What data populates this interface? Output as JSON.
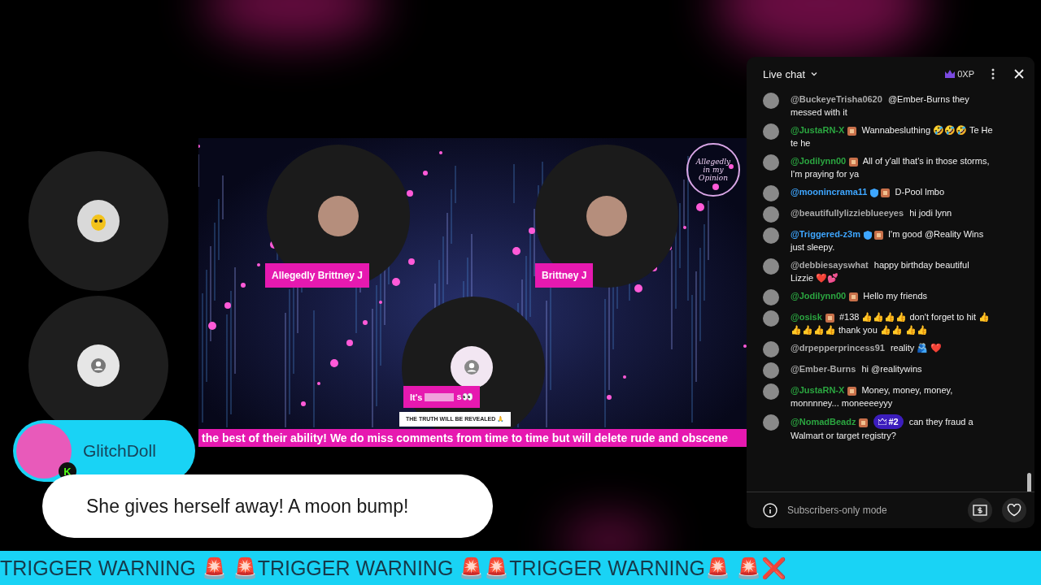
{
  "stage": {
    "side_guests": [
      {
        "kind": "mascot"
      },
      {
        "kind": "default"
      }
    ],
    "video": {
      "hosts": [
        {
          "name": "Allegedly Brittney J"
        },
        {
          "name": "Brittney J"
        }
      ],
      "guest": {
        "tag_start": "It's",
        "tag_end": "s👀",
        "caption": "THE TRUTH WILL BE REVEALED 🙏"
      },
      "logo_text": "Allegedly in my Opinion",
      "ticker": "the best of their ability! We do miss comments from time to time but will delete rude and obscene"
    },
    "featured_comment": {
      "author": "GlitchDoll",
      "badge": "K",
      "message": "She gives herself away! A moon bump!"
    },
    "banner": "TRIGGER WARNING 🚨 🚨TRIGGER WARNING 🚨🚨TRIGGER WARNING🚨  🚨❌"
  },
  "live_chat": {
    "title": "Live chat",
    "xp": "0XP",
    "footer": "Subscribers-only mode",
    "messages": [
      {
        "author": "@BuckeyeTrisha0620",
        "color": "#aaaaaa",
        "text": "@Ember-Burns they messed with it"
      },
      {
        "author": "@JustaRN-X",
        "color": "#2ba640",
        "badges": [
          {
            "kind": "member"
          }
        ],
        "text": "Wannabesluthing 🤣🤣🤣 Te He te he"
      },
      {
        "author": "@Jodilynn00",
        "color": "#2ba640",
        "badges": [
          {
            "kind": "member"
          }
        ],
        "text": "All of y'all that's in those storms, I'm praying for ya"
      },
      {
        "author": "@moonincrama11",
        "color": "#3ea6ff",
        "badges": [
          {
            "kind": "verified"
          },
          {
            "kind": "member"
          }
        ],
        "text": "D-Pool lmbo"
      },
      {
        "author": "@beautifullylizzieblueeyes",
        "color": "#aaaaaa",
        "text": "hi jodi lynn"
      },
      {
        "author": "@Triggered-z3m",
        "color": "#3ea6ff",
        "badges": [
          {
            "kind": "verified"
          },
          {
            "kind": "member"
          }
        ],
        "text": "I'm good @Reality Wins just sleepy."
      },
      {
        "author": "@debbiesayswhat",
        "color": "#aaaaaa",
        "text": "happy birthday beautiful Lizzie ❤️💕"
      },
      {
        "author": "@Jodilynn00",
        "color": "#2ba640",
        "badges": [
          {
            "kind": "member"
          }
        ],
        "text": "Hello my friends"
      },
      {
        "author": "@osisk",
        "color": "#2ba640",
        "badges": [
          {
            "kind": "member"
          }
        ],
        "text": "#138 👍👍👍👍 don't forget to hit 👍👍👍👍👍 thank you 👍👍 👍👍"
      },
      {
        "author": "@drpepperprincess91",
        "color": "#aaaaaa",
        "text": "reality 🫂 ❤️"
      },
      {
        "author": "@Ember-Burns",
        "color": "#aaaaaa",
        "text": "hi @realitywins"
      },
      {
        "author": "@JustaRN-X",
        "color": "#2ba640",
        "badges": [
          {
            "kind": "member"
          }
        ],
        "text": "Money, money, money, monnnney... moneeeeyyy"
      },
      {
        "author": "@NomadBeadz",
        "color": "#2ba640",
        "badges": [
          {
            "kind": "member"
          }
        ],
        "rank": "#2",
        "text": "can they fraud a Walmart or target registry?"
      }
    ]
  }
}
